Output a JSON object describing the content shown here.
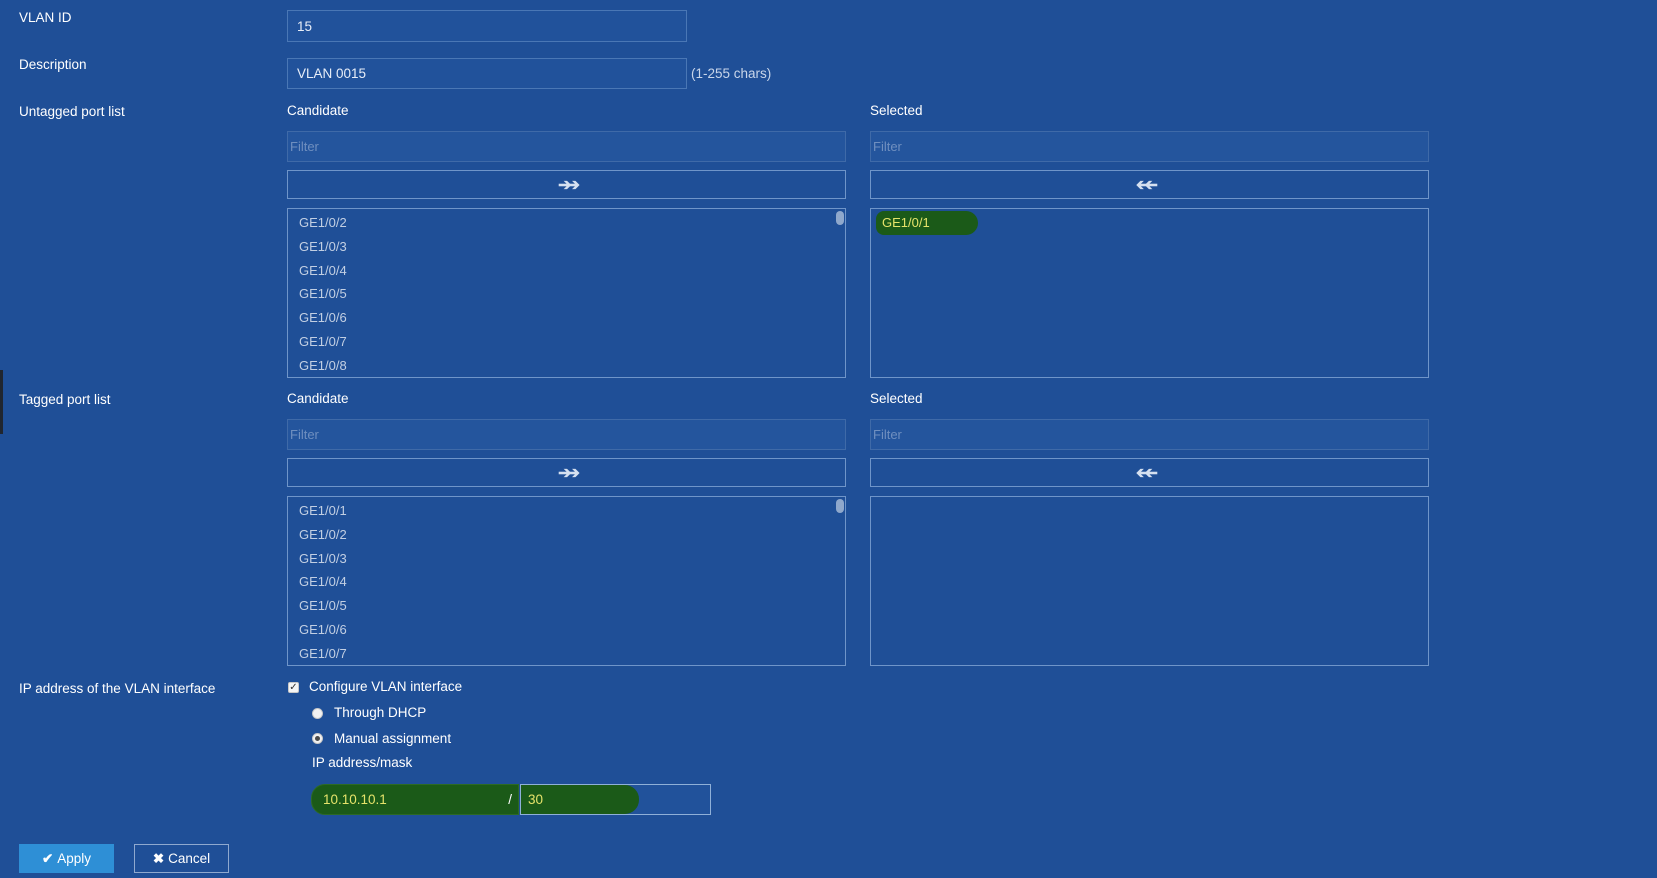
{
  "vlan_id": {
    "label": "VLAN ID",
    "value": "15"
  },
  "description": {
    "label": "Description",
    "value": "VLAN 0015",
    "hint": "(1-255 chars)"
  },
  "untagged": {
    "label": "Untagged port list",
    "candidate_title": "Candidate",
    "selected_title": "Selected",
    "filter_placeholder": "Filter",
    "candidate_items": [
      "GE1/0/2",
      "GE1/0/3",
      "GE1/0/4",
      "GE1/0/5",
      "GE1/0/6",
      "GE1/0/7",
      "GE1/0/8"
    ],
    "selected_items": [
      "GE1/0/1"
    ]
  },
  "tagged": {
    "label": "Tagged port list",
    "candidate_title": "Candidate",
    "selected_title": "Selected",
    "filter_placeholder": "Filter",
    "candidate_items": [
      "GE1/0/1",
      "GE1/0/2",
      "GE1/0/3",
      "GE1/0/4",
      "GE1/0/5",
      "GE1/0/6",
      "GE1/0/7"
    ],
    "selected_items": []
  },
  "ip_section": {
    "label": "IP address of the VLAN interface",
    "configure_checkbox": {
      "label": "Configure VLAN interface",
      "checked": true
    },
    "option_dhcp": {
      "label": "Through DHCP",
      "selected": false
    },
    "option_manual": {
      "label": "Manual assignment",
      "selected": true
    },
    "ip_mask_label": "IP address/mask",
    "ip_value": "10.10.10.1",
    "separator": "/",
    "mask_value": "30"
  },
  "buttons": {
    "apply_label": "Apply",
    "cancel_label": "Cancel"
  },
  "icons": {
    "move_right": "double-arrow-right-icon",
    "move_left": "double-arrow-left-icon",
    "apply": "check-icon",
    "cancel": "close-icon"
  },
  "colors": {
    "background": "#1f4f97",
    "highlight": "#1b5a18",
    "highlight_text": "#e6e36a",
    "apply_button": "#2e8fd6"
  }
}
